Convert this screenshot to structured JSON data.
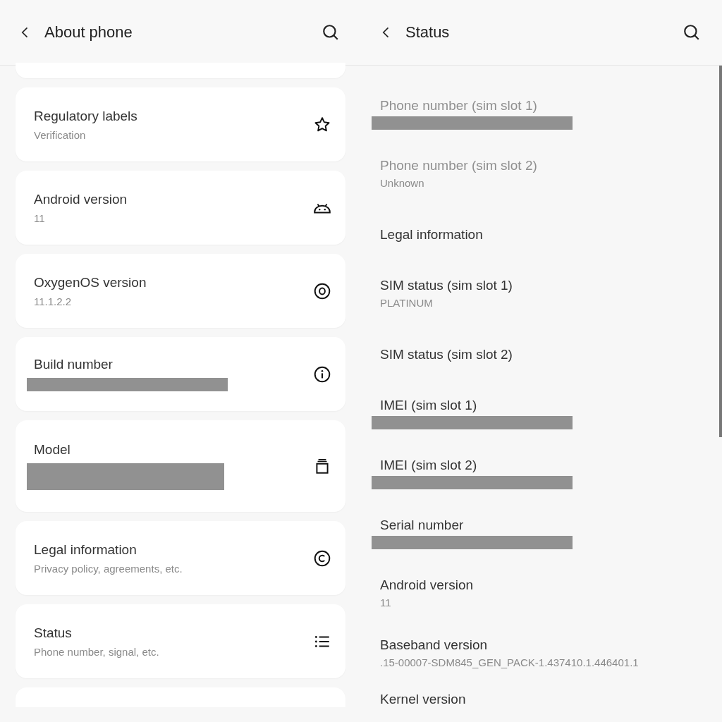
{
  "panels": [
    {
      "title": "About phone",
      "kind": "cards",
      "items": [
        {
          "title": "Regulatory labels",
          "kind": "text",
          "subtitle": "Verification"
        },
        {
          "title": "Android version",
          "kind": "text",
          "subtitle": "11"
        },
        {
          "title": "OxygenOS version",
          "kind": "text",
          "subtitle": "11.1.2.2"
        },
        {
          "title": "Build number",
          "kind": "redacted"
        },
        {
          "title": "Model",
          "kind": "redacted-tall"
        },
        {
          "title": "Legal information",
          "kind": "text",
          "subtitle": "Privacy policy, agreements, etc."
        },
        {
          "title": "Status",
          "kind": "text",
          "subtitle": "Phone number, signal, etc."
        }
      ]
    },
    {
      "title": "Status",
      "kind": "list",
      "items": [
        {
          "title": "Phone number (sim slot 1)",
          "kind": "redacted",
          "disabled": true
        },
        {
          "title": "Phone number (sim slot 2)",
          "kind": "text",
          "subtitle": "Unknown",
          "disabled": true
        },
        {
          "title": "Legal information",
          "kind": "title-only",
          "disabled": false
        },
        {
          "title": "SIM status (sim slot 1)",
          "kind": "text",
          "subtitle": "PLATINUM",
          "disabled": false
        },
        {
          "title": "SIM status (sim slot 2)",
          "kind": "title-only",
          "disabled": false
        },
        {
          "title": "IMEI (sim slot 1)",
          "kind": "redacted",
          "disabled": false
        },
        {
          "title": "IMEI (sim slot 2)",
          "kind": "redacted",
          "disabled": false
        },
        {
          "title": "Serial number",
          "kind": "redacted",
          "disabled": false
        },
        {
          "title": "Android version",
          "kind": "text",
          "subtitle": "11",
          "disabled": false
        },
        {
          "title": "Baseband version",
          "kind": "text",
          "subtitle": ".15-00007-SDM845_GEN_PACK-1.437410.1.446401.1",
          "disabled": false
        },
        {
          "title": "Kernel version",
          "kind": "title-only",
          "disabled": false
        }
      ]
    }
  ]
}
